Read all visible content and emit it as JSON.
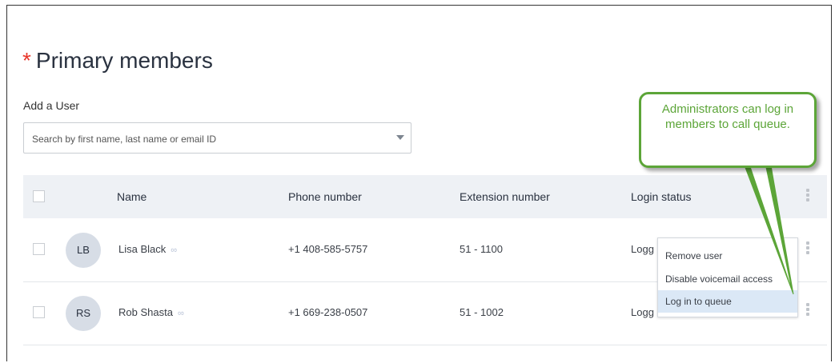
{
  "section": {
    "required_marker": "*",
    "title": "Primary members"
  },
  "add_user": {
    "label": "Add a User",
    "search_placeholder": "Search by first name, last name or email ID"
  },
  "table": {
    "columns": [
      "Name",
      "Phone number",
      "Extension number",
      "Login status"
    ],
    "rows": [
      {
        "initials": "LB",
        "name": "Lisa Black",
        "phone": "+1 408-585-5757",
        "extension": "51 - 1100",
        "status": "Logg"
      },
      {
        "initials": "RS",
        "name": "Rob Shasta",
        "phone": "+1 669-238-0507",
        "extension": "51 - 1002",
        "status": "Logg"
      }
    ]
  },
  "context_menu": {
    "items": [
      "Remove user",
      "Disable voicemail access",
      "Log in to queue"
    ],
    "selected": "Log in to queue"
  },
  "callout": {
    "text": "Administrators can log in members to call queue."
  },
  "colors": {
    "required": "#e8362a",
    "callout_green": "#5ca538",
    "header_bg": "#eef1f5",
    "selected_item_bg": "#dbe8f6"
  },
  "icons": [
    "dropdown-caret-icon",
    "kebab-menu-icon",
    "link-icon"
  ]
}
